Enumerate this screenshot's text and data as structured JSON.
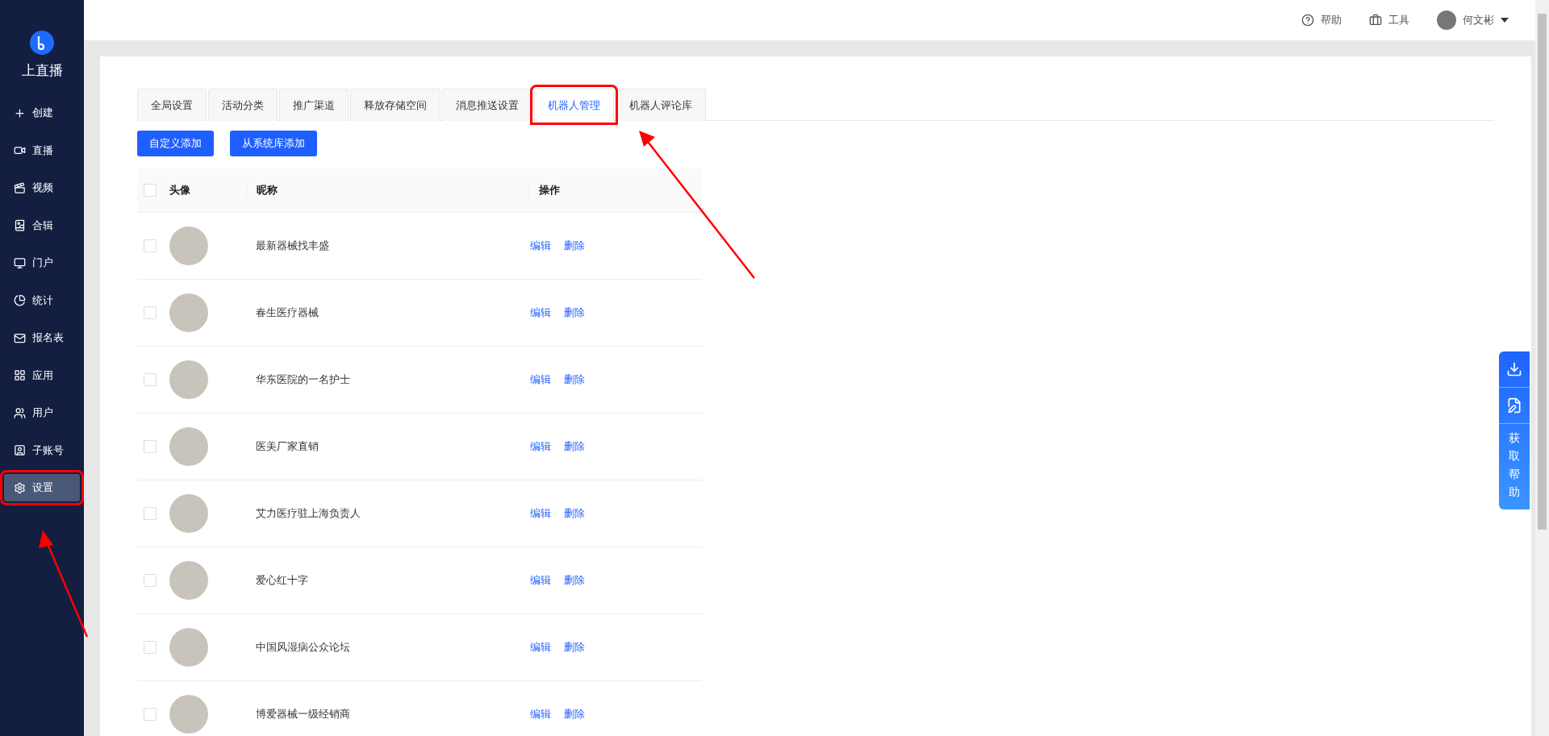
{
  "brand": {
    "name": "上直播"
  },
  "sidebar": {
    "items": [
      {
        "label": "创建",
        "selected": false
      },
      {
        "label": "直播",
        "selected": false
      },
      {
        "label": "视频",
        "selected": false
      },
      {
        "label": "合辑",
        "selected": false
      },
      {
        "label": "门户",
        "selected": false
      },
      {
        "label": "统计",
        "selected": false
      },
      {
        "label": "报名表",
        "selected": false
      },
      {
        "label": "应用",
        "selected": false
      },
      {
        "label": "用户",
        "selected": false
      },
      {
        "label": "子账号",
        "selected": false
      },
      {
        "label": "设置",
        "selected": true
      }
    ]
  },
  "header": {
    "help": "帮助",
    "tools": "工具",
    "user": "何文彬"
  },
  "tabs": [
    {
      "label": "全局设置",
      "selected": false
    },
    {
      "label": "活动分类",
      "selected": false
    },
    {
      "label": "推广渠道",
      "selected": false
    },
    {
      "label": "释放存储空间",
      "selected": false
    },
    {
      "label": "消息推送设置",
      "selected": false
    },
    {
      "label": "机器人管理",
      "selected": true
    },
    {
      "label": "机器人评论库",
      "selected": false
    }
  ],
  "actions": [
    "自定义添加",
    "从系统库添加"
  ],
  "table": {
    "select_all_checked": false,
    "columns": [
      "头像",
      "昵称",
      "操作"
    ],
    "rows": [
      {
        "checked": false,
        "nickname": "最新器械找丰盛",
        "edit": "编辑",
        "delete": "删除"
      },
      {
        "checked": false,
        "nickname": "春生医疗器械",
        "edit": "编辑",
        "delete": "删除"
      },
      {
        "checked": false,
        "nickname": "华东医院的一名护士",
        "edit": "编辑",
        "delete": "删除"
      },
      {
        "checked": false,
        "nickname": "医美厂家直销",
        "edit": "编辑",
        "delete": "删除"
      },
      {
        "checked": false,
        "nickname": "艾力医疗驻上海负责人",
        "edit": "编辑",
        "delete": "删除"
      },
      {
        "checked": false,
        "nickname": "爱心红十字",
        "edit": "编辑",
        "delete": "删除"
      },
      {
        "checked": false,
        "nickname": "中国风湿病公众论坛",
        "edit": "编辑",
        "delete": "删除"
      },
      {
        "checked": false,
        "nickname": "博爱器械一级经销商",
        "edit": "编辑",
        "delete": "删除"
      }
    ]
  },
  "float_panel": {
    "help_text": "获取帮助"
  }
}
